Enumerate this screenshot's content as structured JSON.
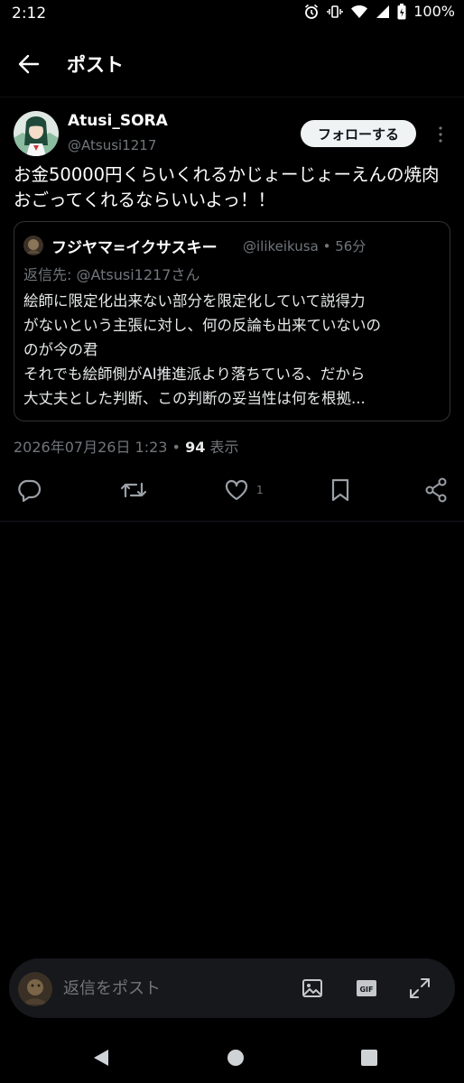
{
  "status_bar": {
    "time": "2:12",
    "battery": "100%"
  },
  "header": {
    "title": "ポスト"
  },
  "author": {
    "name": "Atusi_SORA",
    "handle": "@Atsusi1217",
    "follow_label": "フォローする"
  },
  "post": {
    "text": "お金50000円くらいくれるかじょーじょーえんの焼肉おごってくれるならいいよっ！！"
  },
  "quote": {
    "name": "フジヤマ=イクサスキー",
    "handle": "@ilikeikusa",
    "time": "56分",
    "reply_to": "返信先: @Atsusi1217さん",
    "lines": [
      "絵師に限定化出来ない部分を限定化していて説得力",
      "がないという主張に対し、何の反論も出来ていないの",
      "のが今の君",
      "それでも絵師側がAI推進派より落ちている、だから",
      "大丈夫とした判断、この判断の妥当性は何を根拠..."
    ]
  },
  "meta": {
    "datetime": "2026年07月26日 1:23",
    "views": "94",
    "views_label": "表示"
  },
  "actions": {
    "like_count": "1"
  },
  "composer": {
    "placeholder": "返信をポスト",
    "gif_label": "GIF"
  },
  "icons": [
    "back-arrow",
    "more-vertical",
    "reply",
    "retweet",
    "like",
    "bookmark",
    "share",
    "image",
    "gif",
    "expand",
    "nav-back",
    "nav-home",
    "nav-recents"
  ]
}
